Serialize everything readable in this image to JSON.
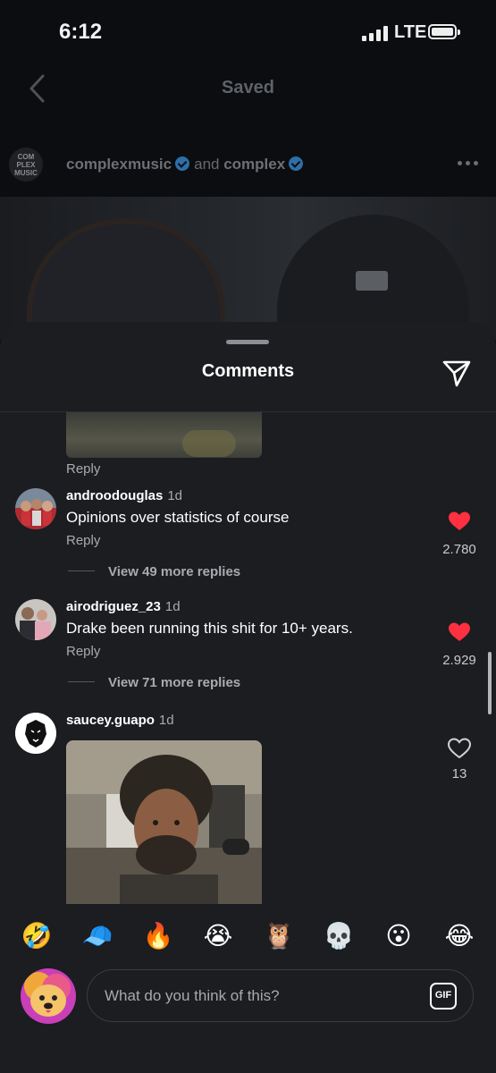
{
  "status_bar": {
    "time": "6:12",
    "network": "LTE",
    "battery_level": 1.0,
    "signal_bars": 4
  },
  "nav": {
    "title": "Saved",
    "back_icon": "chevron-left-icon"
  },
  "post": {
    "avatar_text": "COM\nPLEX\nMUSIC",
    "user1": "complexmusic",
    "joiner": "and",
    "user2": "complex",
    "more_icon": "ellipsis-icon"
  },
  "sheet": {
    "title": "Comments",
    "share_icon": "paper-plane-icon"
  },
  "previous_comment": {
    "reply_label": "Reply"
  },
  "comments": [
    {
      "username": "androodouglas",
      "time": "1d",
      "text": "Opinions over statistics of course",
      "reply_label": "Reply",
      "view_replies": "View 49 more replies",
      "likes": "2.780",
      "liked": true
    },
    {
      "username": "airodriguez_23",
      "time": "1d",
      "text": "Drake been running this shit for 10+ years.",
      "reply_label": "Reply",
      "view_replies": "View 71 more replies",
      "likes": "2.929",
      "liked": true
    },
    {
      "username": "saucey.guapo",
      "time": "1d",
      "likes": "13",
      "liked": false,
      "attachment": "gif"
    }
  ],
  "emoji_reactions": [
    "🤣",
    "🧢",
    "🔥",
    "😭",
    "🦉",
    "💀",
    "😮",
    "😂"
  ],
  "composer": {
    "placeholder": "What do you think of this?",
    "gif_label": "GIF"
  },
  "colors": {
    "like_red": "#ff3040",
    "background": "#1b1d20",
    "text_secondary": "#a8abaf"
  }
}
